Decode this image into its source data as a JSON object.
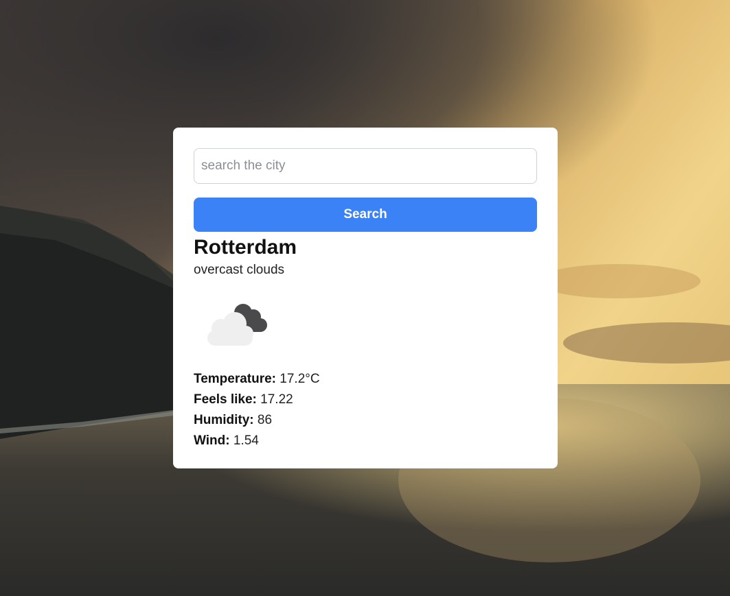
{
  "search": {
    "placeholder": "search the city",
    "value": "",
    "button_label": "Search"
  },
  "weather": {
    "city": "Rotterdam",
    "description": "overcast clouds",
    "icon": "overcast-clouds-icon",
    "stats": [
      {
        "label": "Temperature:",
        "value": "17.2°C"
      },
      {
        "label": "Feels like:",
        "value": "17.22"
      },
      {
        "label": "Humidity:",
        "value": "86"
      },
      {
        "label": "Wind:",
        "value": "1.54"
      }
    ]
  },
  "colors": {
    "accent": "#3b82f6",
    "card_bg": "#ffffff"
  }
}
